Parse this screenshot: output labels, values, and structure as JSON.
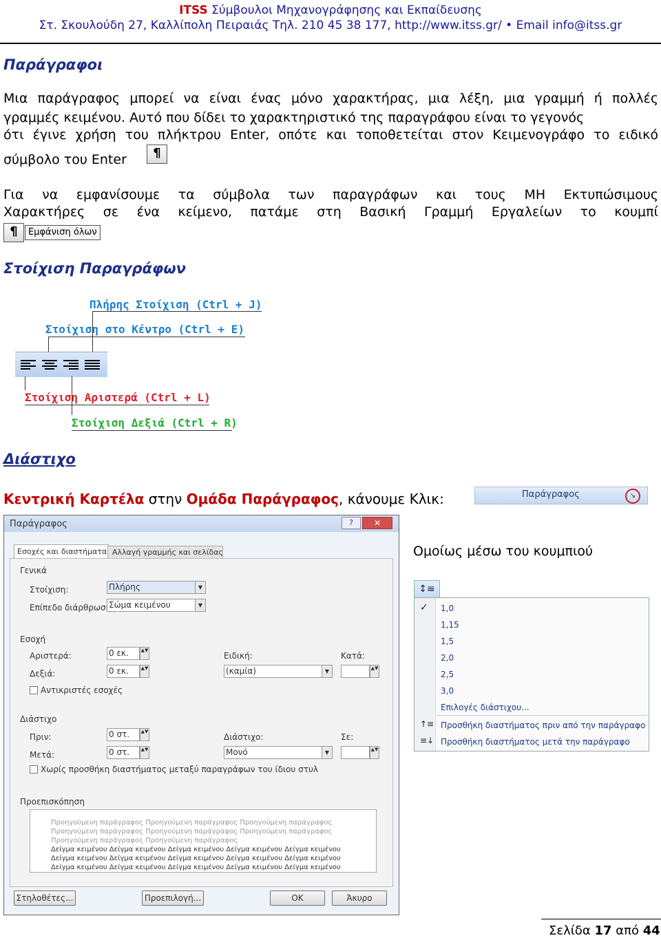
{
  "header": {
    "brand": "ITSS",
    "brand_rest": " Σύμβουλοι Μηχανογράφησης και Εκπαίδευσης",
    "address": "Στ. Σκουλούδη 27, Καλλίπολη Πειραιάς Τηλ. 210 45 38 177, http://www.itss.gr/ •  Email info@itss.gr"
  },
  "sections": {
    "paragraphs_title": "Παράγραφοι",
    "p1_line1": "Μια παράγραφος μπορεί να είναι ένας μόνο χαρακτήρας, μια λέξη, μια γραμμή ή πολλές",
    "p1_line2": "γραμμές κειμένου. Αυτό που δίδει το χαρακτηριστικό της παραγράφου είναι το γεγονός",
    "p1_line3": "ότι έγινε χρήση του πλήκτρου Enter, οπότε και τοποθετείται στον Κειμενογράφο το ειδικό",
    "p1_line4": "σύμβολο του Enter",
    "pilcrow": "¶",
    "p2_line1": "Για να εμφανίσουμε τα σύμβολα των παραγράφων και τους ΜΗ Εκτυπώσιμους",
    "p2_line2": "Χαρακτήρες σε ένα κείμενο, πατάμε στη Βασική Γραμμή Εργαλείων το κουμπί",
    "show_all": "Εμφάνιση όλων",
    "alignment_title": "Στοίχιση Παραγράφων",
    "spacing_title": "Διάστιχο",
    "tab_text_a": "Κεντρική Καρτέλα",
    "tab_text_b": " στην ",
    "tab_text_c": "Ομάδα Παράγραφος",
    "tab_text_d": ", κάνουμε Κλικ:",
    "similarly": "Ομοίως μέσω του κουμπιού"
  },
  "alignment_labels": {
    "justify": "Πλήρης Στοίχιση (Ctrl + J)",
    "center": "Στοίχιση στο Κέντρο (Ctrl + E)",
    "left": "Στοίχιση Αριστερά (Ctrl + L)",
    "right": "Στοίχιση Δεξιά (Ctrl + R)"
  },
  "ribbon": {
    "group_label": "Παράγραφος"
  },
  "dialog": {
    "title": "Παράγραφος",
    "tab1": "Εσοχές και διαστήματα",
    "tab2": "Αλλαγή γραμμής και σελίδας",
    "general": "Γενικά",
    "alignment_label": "Στοίχιση:",
    "alignment_value": "Πλήρης",
    "outline_label": "Επίπεδο διάρθρωσης:",
    "outline_value": "Σώμα κειμένου",
    "indent": "Εσοχή",
    "left_label": "Αριστερά:",
    "left_value": "0 εκ.",
    "right_label": "Δεξιά:",
    "right_value": "0 εκ.",
    "special_label": "Ειδική:",
    "special_value": "(καμία)",
    "by_label": "Κατά:",
    "mirror": "Αντικριστές εσοχές",
    "spacing": "Διάστιχο",
    "before_label": "Πριν:",
    "before_value": "0 στ.",
    "after_label": "Μετά:",
    "after_value": "0 στ.",
    "line_label": "Διάστιχο:",
    "line_value": "Μονό",
    "at_label": "Σε:",
    "no_space": "Χωρίς προσθήκη διαστήματος μεταξύ παραγράφων του ίδιου στυλ",
    "preview": "Προεπισκόπηση",
    "preview_prev": "Προηγούμενη παράγραφος Προηγούμενη παράγραφος Προηγούμενη παράγραφος",
    "preview_prev2": "Προηγούμενη παράγραφος Προηγούμενη παράγραφος",
    "preview_sample": "Δείγμα κειμένου Δείγμα κειμένου Δείγμα κειμένου Δείγμα κειμένου Δείγμα κειμένου",
    "btn_tabs": "Στηλοθέτες...",
    "btn_default": "Προεπιλογή...",
    "btn_ok": "OK",
    "btn_cancel": "Άκυρο"
  },
  "line_spacing_menu": {
    "items": [
      "1,0",
      "1,15",
      "1,5",
      "2,0",
      "2,5",
      "3,0"
    ],
    "options": "Επιλογές διάστιχου...",
    "add_before": "Προσθήκη διαστήματος πριν από την παράγραφο",
    "add_after": "Προσθήκη  διαστήματος μετά την παράγραφο"
  },
  "footer": {
    "page_prefix": "Σελίδα ",
    "page_num": "17",
    "page_mid": " από ",
    "page_total": "44"
  }
}
